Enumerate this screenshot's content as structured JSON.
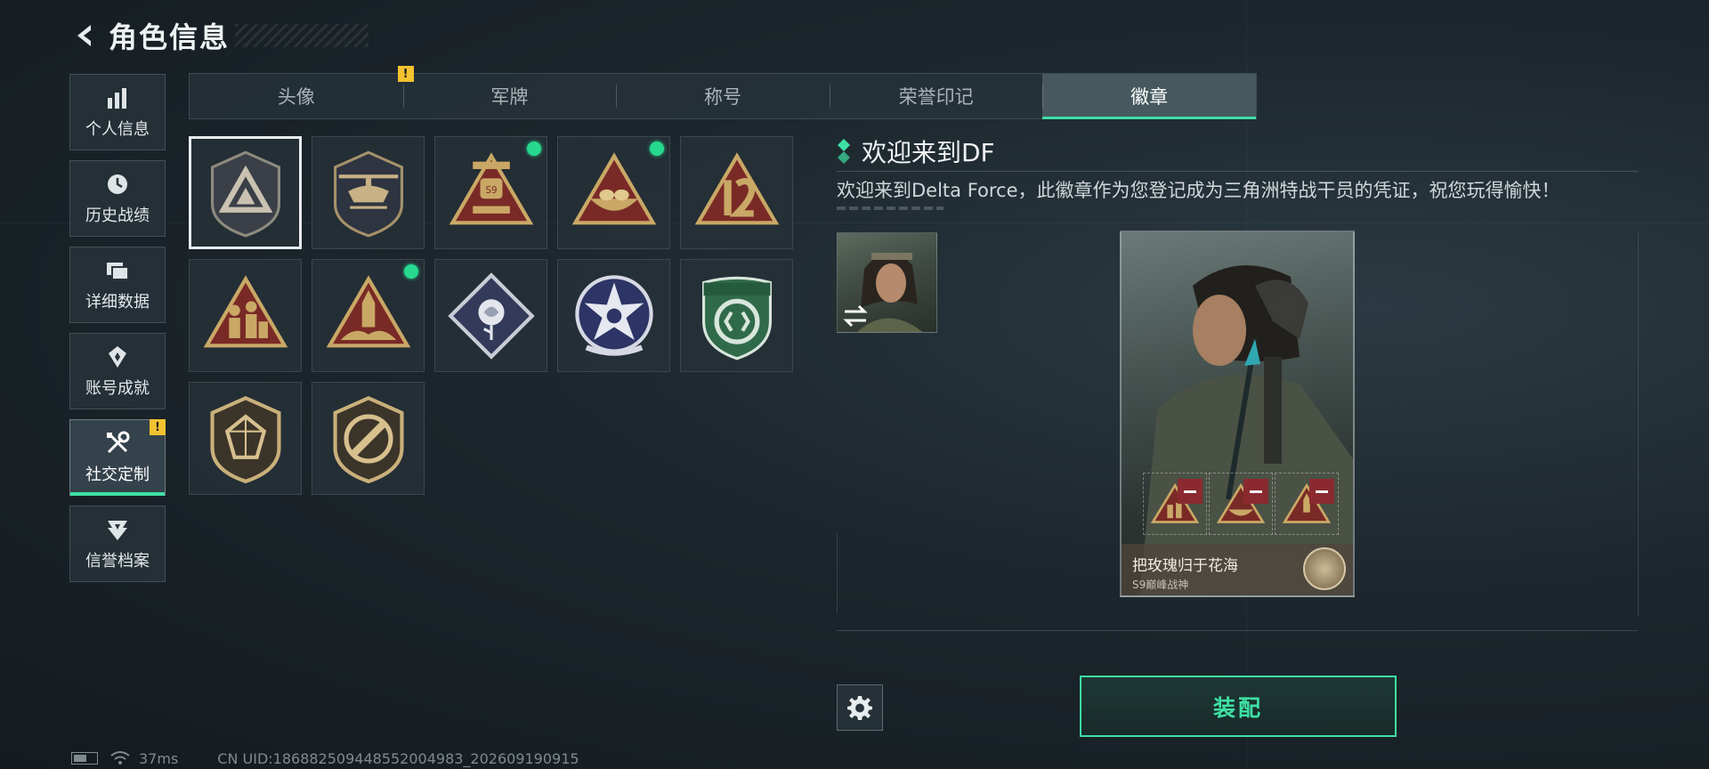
{
  "header": {
    "title": "角色信息"
  },
  "sidebar": {
    "items": [
      {
        "label": "个人信息",
        "icon": "bar-chart-icon"
      },
      {
        "label": "历史战绩",
        "icon": "clock-icon"
      },
      {
        "label": "详细数据",
        "icon": "folders-icon"
      },
      {
        "label": "账号成就",
        "icon": "medal-icon"
      },
      {
        "label": "社交定制",
        "icon": "tools-icon",
        "active": true,
        "warning": "!"
      },
      {
        "label": "信誉档案",
        "icon": "shield-rank-icon"
      }
    ]
  },
  "tabs": [
    {
      "label": "头像",
      "warning": "!"
    },
    {
      "label": "军牌"
    },
    {
      "label": "称号"
    },
    {
      "label": "荣誉印记"
    },
    {
      "label": "徽章",
      "active": true
    }
  ],
  "badges": [
    {
      "name": "delta-force-badge",
      "selected": true,
      "new": false
    },
    {
      "name": "helicopter-badge",
      "new": false
    },
    {
      "name": "s9-badge",
      "new": true
    },
    {
      "name": "nest-badge",
      "new": true
    },
    {
      "name": "number-twelve-badge",
      "new": false
    },
    {
      "name": "soldiers-badge",
      "new": false
    },
    {
      "name": "rocket-badge",
      "new": true
    },
    {
      "name": "rose-badge",
      "new": false
    },
    {
      "name": "star-wheel-badge",
      "new": false
    },
    {
      "name": "green-shield-badge",
      "new": false
    },
    {
      "name": "gem-shield-badge",
      "new": false
    },
    {
      "name": "knife-shield-badge",
      "new": false
    }
  ],
  "detail": {
    "name": "欢迎来到DF",
    "description": "欢迎来到Delta Force，此徽章作为您登记成为三角洲特战干员的凭证，祝您玩得愉快！"
  },
  "card": {
    "name": "把玫瑰归于花海",
    "subtitle": "S9巅峰战神"
  },
  "actions": {
    "equip_label": "装配"
  },
  "status": {
    "ping": "37ms",
    "uid": "CN UID:18688250944855200498​3_202609190915"
  },
  "colors": {
    "accent": "#3ee0a4",
    "warning": "#f2c230",
    "badge_gold": "#c9a866",
    "badge_red": "#7a2a26"
  }
}
